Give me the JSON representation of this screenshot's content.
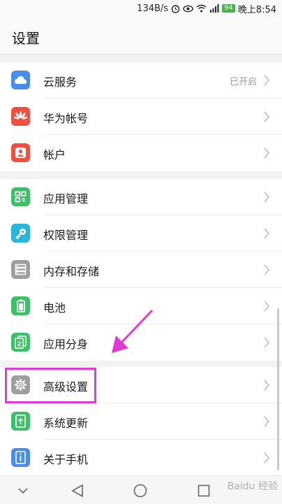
{
  "status_bar": {
    "speed": "134B/s",
    "alarm_icon": "alarm-icon",
    "eye_icon": "eye-icon",
    "wifi_icon": "wifi-icon",
    "signal_icon": "signal-icon",
    "battery_level": "94",
    "time": "晚上8:54"
  },
  "header": {
    "title": "设置"
  },
  "groups": [
    {
      "items": [
        {
          "label": "云服务",
          "value": "已开启",
          "icon": "cloud-icon",
          "color": "#4a8de8"
        },
        {
          "label": "华为帐号",
          "value": "",
          "icon": "huawei-icon",
          "color": "#f0503f"
        },
        {
          "label": "帐户",
          "value": "",
          "icon": "account-icon",
          "color": "#f0503f"
        }
      ]
    },
    {
      "items": [
        {
          "label": "应用管理",
          "value": "",
          "icon": "apps-icon",
          "color": "#3fbf6a"
        },
        {
          "label": "权限管理",
          "value": "",
          "icon": "key-icon",
          "color": "#2bb5d8"
        },
        {
          "label": "内存和存储",
          "value": "",
          "icon": "storage-icon",
          "color": "#9e9e9e"
        },
        {
          "label": "电池",
          "value": "",
          "icon": "battery-icon",
          "color": "#3fbf6a"
        },
        {
          "label": "应用分身",
          "value": "",
          "icon": "app-twin-icon",
          "color": "#3fbf6a"
        }
      ]
    },
    {
      "items": [
        {
          "label": "高级设置",
          "value": "",
          "icon": "gear-icon",
          "color": "#9e9e9e"
        },
        {
          "label": "系统更新",
          "value": "",
          "icon": "update-icon",
          "color": "#3fbf6a"
        },
        {
          "label": "关于手机",
          "value": "",
          "icon": "info-icon",
          "color": "#4a8de8"
        }
      ]
    }
  ],
  "annotation": {
    "color": "#e03ad6"
  },
  "navbar": {
    "down_icon": "chevron-down-icon",
    "back_icon": "back-icon",
    "home_icon": "home-icon",
    "recent_icon": "recent-icon",
    "watermark": "Baidu 经验"
  }
}
